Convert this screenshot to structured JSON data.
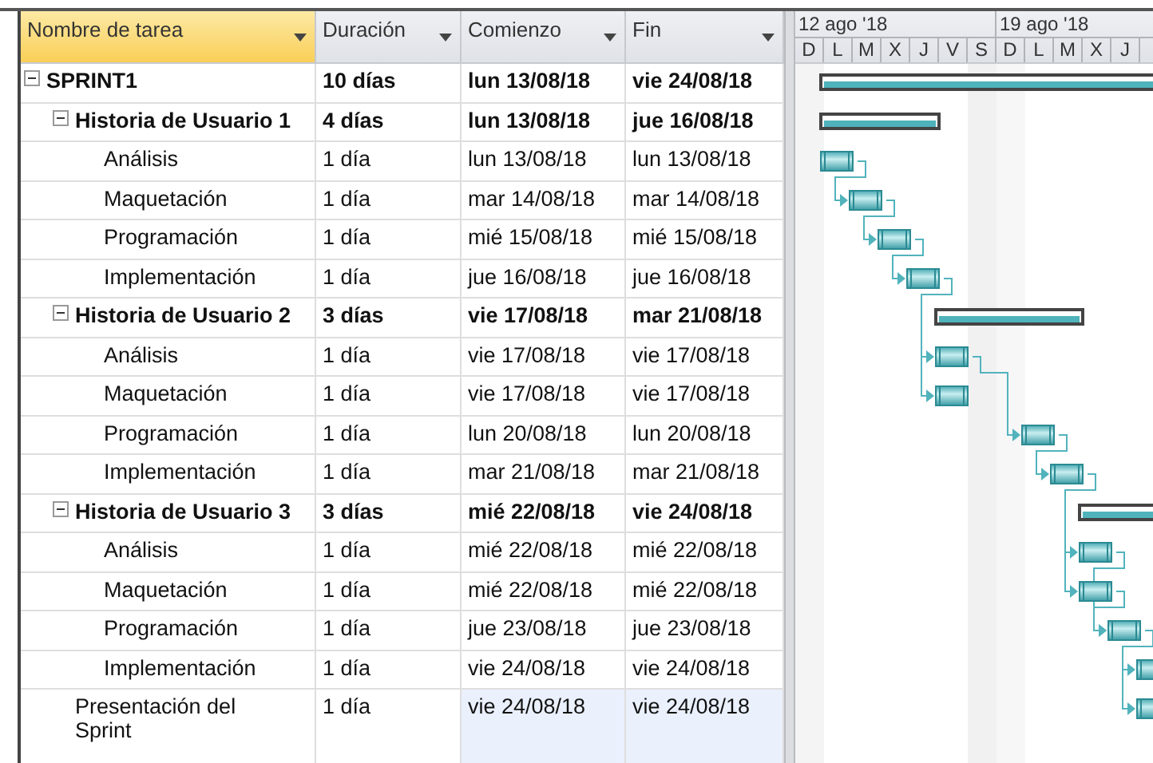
{
  "columns": [
    {
      "label": "Nombre de tarea",
      "selected": true
    },
    {
      "label": "Duración",
      "selected": false
    },
    {
      "label": "Comienzo",
      "selected": false
    },
    {
      "label": "Fin",
      "selected": false
    }
  ],
  "tasks": [
    {
      "name": "SPRINT1",
      "kind": "summary",
      "expanded": true,
      "selected": false,
      "duration": "10 días",
      "start": "lun 13/08/18",
      "end": "vie 24/08/18",
      "children": [
        {
          "name": "Historia de Usuario 1",
          "kind": "summary",
          "expanded": true,
          "selected": false,
          "duration": "4 días",
          "start": "lun 13/08/18",
          "end": "jue 16/08/18",
          "children": [
            {
              "name": "Análisis",
              "kind": "task",
              "selected": false,
              "duration": "1 día",
              "start": "lun 13/08/18",
              "end": "lun 13/08/18"
            },
            {
              "name": "Maquetación",
              "kind": "task",
              "selected": false,
              "duration": "1 día",
              "start": "mar 14/08/18",
              "end": "mar 14/08/18"
            },
            {
              "name": "Programación",
              "kind": "task",
              "selected": false,
              "duration": "1 día",
              "start": "mié 15/08/18",
              "end": "mié 15/08/18"
            },
            {
              "name": "Implementación",
              "kind": "task",
              "selected": false,
              "duration": "1 día",
              "start": "jue 16/08/18",
              "end": "jue 16/08/18"
            }
          ]
        },
        {
          "name": "Historia de Usuario 2",
          "kind": "summary",
          "expanded": true,
          "selected": false,
          "duration": "3 días",
          "start": "vie 17/08/18",
          "end": "mar 21/08/18",
          "children": [
            {
              "name": "Análisis",
              "kind": "task",
              "selected": false,
              "duration": "1 día",
              "start": "vie 17/08/18",
              "end": "vie 17/08/18"
            },
            {
              "name": "Maquetación",
              "kind": "task",
              "selected": false,
              "duration": "1 día",
              "start": "vie 17/08/18",
              "end": "vie 17/08/18"
            },
            {
              "name": "Programación",
              "kind": "task",
              "selected": false,
              "duration": "1 día",
              "start": "lun 20/08/18",
              "end": "lun 20/08/18"
            },
            {
              "name": "Implementación",
              "kind": "task",
              "selected": false,
              "duration": "1 día",
              "start": "mar 21/08/18",
              "end": "mar 21/08/18"
            }
          ]
        },
        {
          "name": "Historia de Usuario 3",
          "kind": "summary",
          "expanded": true,
          "selected": false,
          "duration": "3 días",
          "start": "mié 22/08/18",
          "end": "vie 24/08/18",
          "children": [
            {
              "name": "Análisis",
              "kind": "task",
              "selected": false,
              "duration": "1 día",
              "start": "mié 22/08/18",
              "end": "mié 22/08/18"
            },
            {
              "name": "Maquetación",
              "kind": "task",
              "selected": false,
              "duration": "1 día",
              "start": "mié 22/08/18",
              "end": "mié 22/08/18"
            },
            {
              "name": "Programación",
              "kind": "task",
              "selected": false,
              "duration": "1 día",
              "start": "jue 23/08/18",
              "end": "jue 23/08/18"
            },
            {
              "name": "Implementación",
              "kind": "task",
              "selected": false,
              "duration": "1 día",
              "start": "vie 24/08/18",
              "end": "vie 24/08/18"
            }
          ]
        },
        {
          "name": "Presentación del Sprint",
          "kind": "task",
          "selected": true,
          "duration": "1 día",
          "start": "vie 24/08/18",
          "end": "vie 24/08/18"
        }
      ]
    }
  ],
  "timescale": {
    "weeks": [
      "12 ago '18",
      "19 ago '18"
    ],
    "days": [
      "D",
      "L",
      "M",
      "X",
      "J",
      "V",
      "S",
      "D",
      "L",
      "M",
      "X",
      "J"
    ]
  }
}
